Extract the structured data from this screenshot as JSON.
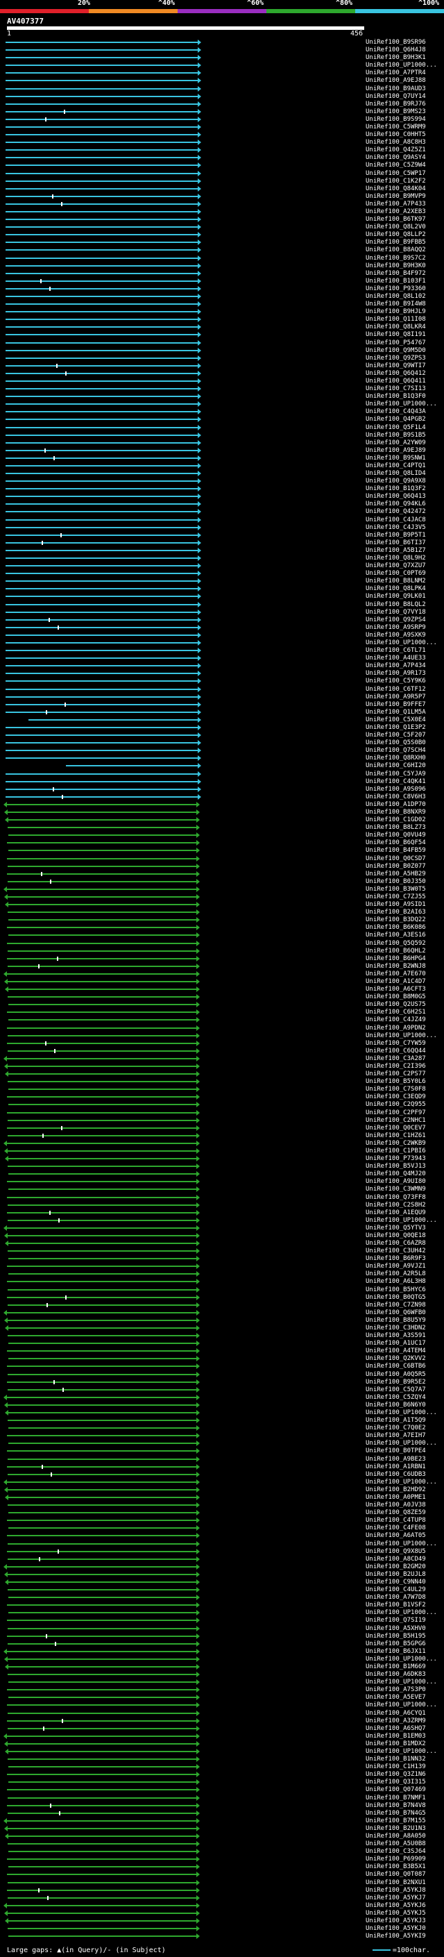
{
  "query": {
    "title": "AV407377",
    "start_label": "1",
    "end_label": "456"
  },
  "identity_scale": {
    "labels": [
      "20%",
      "^40%",
      "^60%",
      "^80%",
      "^100%"
    ],
    "colors": [
      "#e0202a",
      "#f08a24",
      "#9a2ec0",
      "#2ea82e",
      "#39c4e0"
    ]
  },
  "footer": {
    "gap_text": "Large gaps: ▲(in Query)/- (in Subject)",
    "legend_text": "=100char."
  },
  "hits": [
    "UniRef100_B9SR96",
    "UniRef100_Q6H4J8",
    "UniRef100_B9H3K1",
    "UniRef100_UP1000...",
    "UniRef100_A7PTR4",
    "UniRef100_A9EJ88",
    "UniRef100_B9AUD3",
    "UniRef100_Q7UY14",
    "UniRef100_B9RJ76",
    "UniRef100_B9MS23",
    "UniRef100_B9S994",
    "UniRef100_C5WRM9",
    "UniRef100_C0HHT5",
    "UniRef100_A8C8H3",
    "UniRef100_Q4Z5Z1",
    "UniRef100_Q9ASY4",
    "UniRef100_C5Z9W4",
    "UniRef100_C5WP17",
    "UniRef100_C1K2F2",
    "UniRef100_Q84K04",
    "UniRef100_B9MVP9",
    "UniRef100_A7P433",
    "UniRef100_A2XEB3",
    "UniRef100_B6TK97",
    "UniRef100_Q8L2V0",
    "UniRef100_Q8LLP2",
    "UniRef100_B9FBB5",
    "UniRef100_B8AQQ2",
    "UniRef100_B9S7C2",
    "UniRef100_B9H3K0",
    "UniRef100_B4F972",
    "UniRef100_B103F1",
    "UniRef100_P93360",
    "UniRef100_Q8L102",
    "UniRef100_B9I4W8",
    "UniRef100_B9HJL9",
    "UniRef100_Q11I08",
    "UniRef100_Q8LKR4",
    "UniRef100_Q8I191",
    "UniRef100_P54767",
    "UniRef100_Q9M5D0",
    "UniRef100_Q9ZPS3",
    "UniRef100_Q9WTI7",
    "UniRef100_Q6Q412",
    "UniRef100_Q6Q411",
    "UniRef100_C7SI13",
    "UniRef100_B1Q3F0",
    "UniRef100_UP1000...",
    "UniRef100_C4Q43A",
    "UniRef100_Q4PGB2",
    "UniRef100_Q5F1L4",
    "UniRef100_B9S1B5",
    "UniRef100_A2YW09",
    "UniRef100_A9EJ89",
    "UniRef100_B9SNW1",
    "UniRef100_C4PTQ1",
    "UniRef100_Q8LID4",
    "UniRef100_Q9A9X8",
    "UniRef100_B1Q3F2",
    "UniRef100_Q6Q413",
    "UniRef100_Q94KL6",
    "UniRef100_Q42472",
    "UniRef100_C4JAC8",
    "UniRef100_C4J3V5",
    "UniRef100_B9P5T1",
    "UniRef100_B6TI37",
    "UniRef100_A5B1Z7",
    "UniRef100_Q8L9H2",
    "UniRef100_Q7XZU7",
    "UniRef100_C0PT69",
    "UniRef100_B8LNM2",
    "UniRef100_Q8LPK4",
    "UniRef100_Q9LK01",
    "UniRef100_B8LQL2",
    "UniRef100_Q7VY18",
    "UniRef100_Q9ZPS4",
    "UniRef100_A9SRP9",
    "UniRef100_A9SXK9",
    "UniRef100_UP1000...",
    "UniRef100_C6TL71",
    "UniRef100_A4UE33",
    "UniRef100_A7P434",
    "UniRef100_A9R173",
    "UniRef100_C5Y9K6",
    "UniRef100_C6TF12",
    "UniRef100_A9R5P7",
    "UniRef100_B9FFE7",
    "UniRef100_Q1LM5A",
    "UniRef100_C5X0E4",
    "UniRef100_Q1E3P2",
    "UniRef100_C5F207",
    "UniRef100_Q5S0B0",
    "UniRef100_Q7SCH4",
    "UniRef100_Q8RXH0",
    "UniRef100_C6HI20",
    "UniRef100_C5YJA9",
    "UniRef100_C4QK41",
    "UniRef100_A9S096",
    "UniRef100_C8V6H3",
    "UniRef100_A1DP70",
    "UniRef100_B8NXR9",
    "UniRef100_C1GD02",
    "UniRef100_B8LZ73",
    "UniRef100_Q0VU49",
    "UniRef100_B6QF54",
    "UniRef100_B4FB59",
    "UniRef100_Q0CSD7",
    "UniRef100_B0Z077",
    "UniRef100_A5HB29",
    "UniRef100_B0J350",
    "UniRef100_B3W0T5",
    "UniRef100_C7ZJ55",
    "UniRef100_A9SID1",
    "UniRef100_B2AI63",
    "UniRef100_B3DQ22",
    "UniRef100_B6K086",
    "UniRef100_A3ES16",
    "UniRef100_Q5Q592",
    "UniRef100_B6QHL2",
    "UniRef100_B6HPG4",
    "UniRef100_B2WNJ8",
    "UniRef100_A7E670",
    "UniRef100_A1C4D7",
    "UniRef100_A6CFT3",
    "UniRef100_B8M0G5",
    "UniRef100_Q2US75",
    "UniRef100_C6H2S1",
    "UniRef100_C4JZ49",
    "UniRef100_A9PDN2",
    "UniRef100_UP1000...",
    "UniRef100_C7YW59",
    "UniRef100_C6QQ44",
    "UniRef100_C3A287",
    "UniRef100_C2I396",
    "UniRef100_C2PS77",
    "UniRef100_B5Y0L6",
    "UniRef100_C7S0F8",
    "UniRef100_C3EQD9",
    "UniRef100_C2Q955",
    "UniRef100_C2PF97",
    "UniRef100_C2NHC1",
    "UniRef100_Q0CEV7",
    "UniRef100_C1HZ61",
    "UniRef100_C2WKB9",
    "UniRef100_C1PBI6",
    "UniRef100_P73943",
    "UniRef100_B5VJ13",
    "UniRef100_Q4MJ20",
    "UniRef100_A9UI80",
    "UniRef100_C3WMN9",
    "UniRef100_Q73FF8",
    "UniRef100_C2S8H2",
    "UniRef100_A1EQU9",
    "UniRef100_UP1000...",
    "UniRef100_Q5YTV3",
    "UniRef100_Q0QE18",
    "UniRef100_C6AZR8",
    "UniRef100_C3UH42",
    "UniRef100_B6R9F3",
    "UniRef100_A9VJZ1",
    "UniRef100_A2R5L8",
    "UniRef100_A6L3H8",
    "UniRef100_B5HYC6",
    "UniRef100_B0QTG5",
    "UniRef100_C7ZN98",
    "UniRef100_Q6WFB0",
    "UniRef100_B8U5Y9",
    "UniRef100_C3HDN2",
    "UniRef100_A3S591",
    "UniRef100_A1UC17",
    "UniRef100_A4TEM4",
    "UniRef100_Q2KVV2",
    "UniRef100_C6BTB6",
    "UniRef100_A0Q5R5",
    "UniRef100_B9R5E2",
    "UniRef100_C5Q7A7",
    "UniRef100_C5ZQY4",
    "UniRef100_B6N6Y0",
    "UniRef100_UP1000...",
    "UniRef100_A1T5Q9",
    "UniRef100_C7Q0E2",
    "UniRef100_A7EIH7",
    "UniRef100_UP1000...",
    "UniRef100_B0TPE4",
    "UniRef100_A9BE23",
    "UniRef100_A1RBN1",
    "UniRef100_C6UDB3",
    "UniRef100_UP1000...",
    "UniRef100_B2HD92",
    "UniRef100_A0PME1",
    "UniRef100_A0JV38",
    "UniRef100_Q8ZE59",
    "UniRef100_C4TUP8",
    "UniRef100_C4FE08",
    "UniRef100_A6AT05",
    "UniRef100_UP1000...",
    "UniRef100_Q9X8U5",
    "UniRef100_A8CD49",
    "UniRef100_B2GM20",
    "UniRef100_B2UJL8",
    "UniRef100_C9NN40",
    "UniRef100_C4UL29",
    "UniRef100_A7W7D8",
    "UniRef100_B1VSF2",
    "UniRef100_UP1000...",
    "UniRef100_Q7SI19",
    "UniRef100_A5XHV0",
    "UniRef100_B5H195",
    "UniRef100_B5GPG6",
    "UniRef100_B6JX11",
    "UniRef100_UP1000...",
    "UniRef100_B1M669",
    "UniRef100_A6DK83",
    "UniRef100_UP1000...",
    "UniRef100_A7S3P0",
    "UniRef100_A5EVE7",
    "UniRef100_UP1000...",
    "UniRef100_A6CYQ1",
    "UniRef100_A3ZRM9",
    "UniRef100_A6SHQ7",
    "UniRef100_B1EM03",
    "UniRef100_B1MDX2",
    "UniRef100_UP1000...",
    "UniRef100_B1NN32",
    "UniRef100_C1H139",
    "UniRef100_Q3Z1N6",
    "UniRef100_Q3I315",
    "UniRef100_Q07469",
    "UniRef100_B7NMF1",
    "UniRef100_B7N4V8",
    "UniRef100_B7N4G5",
    "UniRef100_B7M155",
    "UniRef100_B2U1N3",
    "UniRef100_A8A050",
    "UniRef100_A5U0B8",
    "UniRef100_C3SJ64",
    "UniRef100_P69909",
    "UniRef100_B3B5X1",
    "UniRef100_Q0T087",
    "UniRef100_B2NXU1",
    "UniRef100_A5YKJ8",
    "UniRef100_A5YKJ7",
    "UniRef100_A5YKJ6",
    "UniRef100_A5YKJ5",
    "UniRef100_A5YKJ3",
    "UniRef100_A5YKJ0",
    "UniRef100_A5YKI9"
  ]
}
